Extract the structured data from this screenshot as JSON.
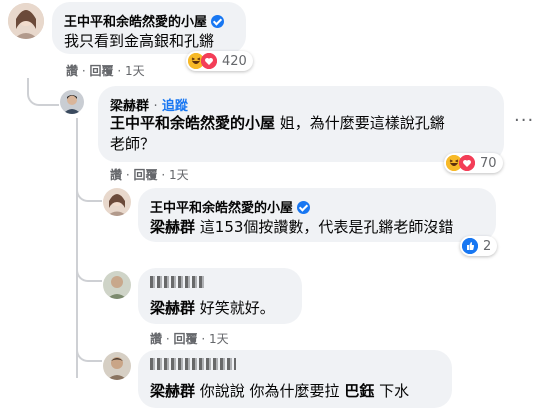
{
  "comments": [
    {
      "author": "王中平和余皓然愛的小屋",
      "verified": true,
      "text": "我只看到金高銀和孔鏘",
      "reaction_count": "420",
      "actions": {
        "like": "讚",
        "reply": "回覆",
        "time": "1天"
      }
    },
    {
      "author": "梁赫群",
      "follow": "追蹤",
      "tag": "王中平和余皓然愛的小屋",
      "text": " 姐，為什麼要這樣說孔鏘",
      "text2": "老師？",
      "reaction_count": "70",
      "actions": {
        "like": "讚",
        "reply": "回覆",
        "time": "1天"
      }
    },
    {
      "author": "王中平和余皓然愛的小屋",
      "verified": true,
      "tag": "梁赫群",
      "text": " 這153個按讚數，代表是孔鏘老師沒錯",
      "reaction_count": "2"
    },
    {
      "tag": "梁赫群",
      "text": " 好笑就好。",
      "actions": {
        "like": "讚",
        "reply": "回覆",
        "time": "1天"
      }
    },
    {
      "tag": "梁赫群",
      "text": " 你說說 你為什麼要拉 ",
      "tag2": "巴鈺",
      "text2": " 下水"
    }
  ],
  "separator": "·",
  "more_icon": "more-horizontal-icon",
  "colors": {
    "bubble": "#f0f2f5",
    "verified": "#1877f2",
    "meta": "#65676b",
    "thread": "#ced0d4"
  }
}
